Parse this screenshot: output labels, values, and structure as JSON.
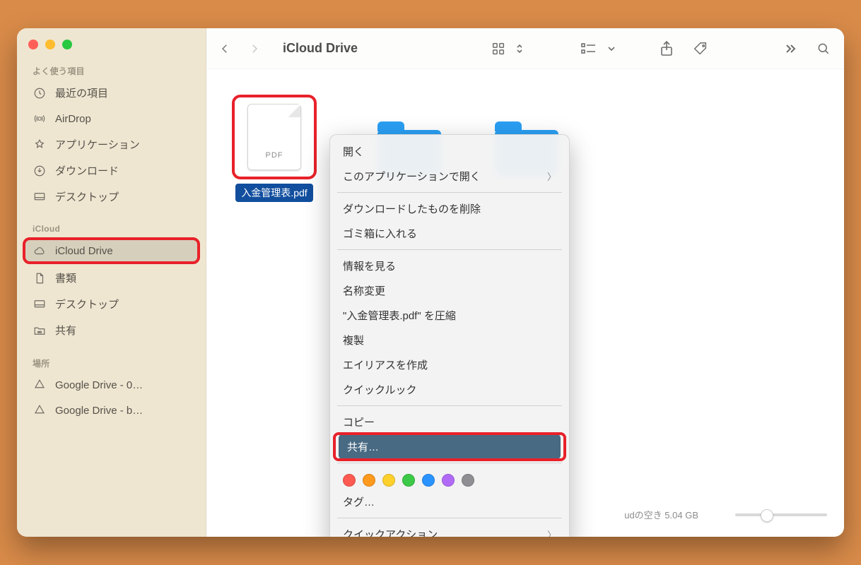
{
  "window": {
    "title": "iCloud Drive"
  },
  "sidebar": {
    "sections": {
      "favorites": {
        "title": "よく使う項目",
        "items": [
          {
            "label": "最近の項目"
          },
          {
            "label": "AirDrop"
          },
          {
            "label": "アプリケーション"
          },
          {
            "label": "ダウンロード"
          },
          {
            "label": "デスクトップ"
          }
        ]
      },
      "icloud": {
        "title": "iCloud",
        "items": [
          {
            "label": "iCloud Drive",
            "active": true
          },
          {
            "label": "書類"
          },
          {
            "label": "デスクトップ"
          },
          {
            "label": "共有"
          }
        ]
      },
      "locations": {
        "title": "場所",
        "items": [
          {
            "label": "Google Drive - 0…"
          },
          {
            "label": "Google Drive - b…"
          }
        ]
      }
    }
  },
  "files": {
    "selected": {
      "name": "入金管理表.pdf",
      "badge": "PDF"
    }
  },
  "context_menu": {
    "open": "開く",
    "open_with": "このアプリケーションで開く",
    "remove_download": "ダウンロードしたものを削除",
    "trash": "ゴミ箱に入れる",
    "get_info": "情報を見る",
    "rename": "名称変更",
    "compress": "\"入金管理表.pdf\" を圧縮",
    "duplicate": "複製",
    "make_alias": "エイリアスを作成",
    "quicklook": "クイックルック",
    "copy": "コピー",
    "share": "共有…",
    "tags": "タグ…",
    "quick_actions": "クイックアクション"
  },
  "tag_colors": [
    "#ff5a52",
    "#ff9a1f",
    "#ffd02b",
    "#3cc947",
    "#2a93ff",
    "#b16af6",
    "#8e8e93"
  ],
  "status": {
    "text": "udの空き 5.04 GB"
  }
}
